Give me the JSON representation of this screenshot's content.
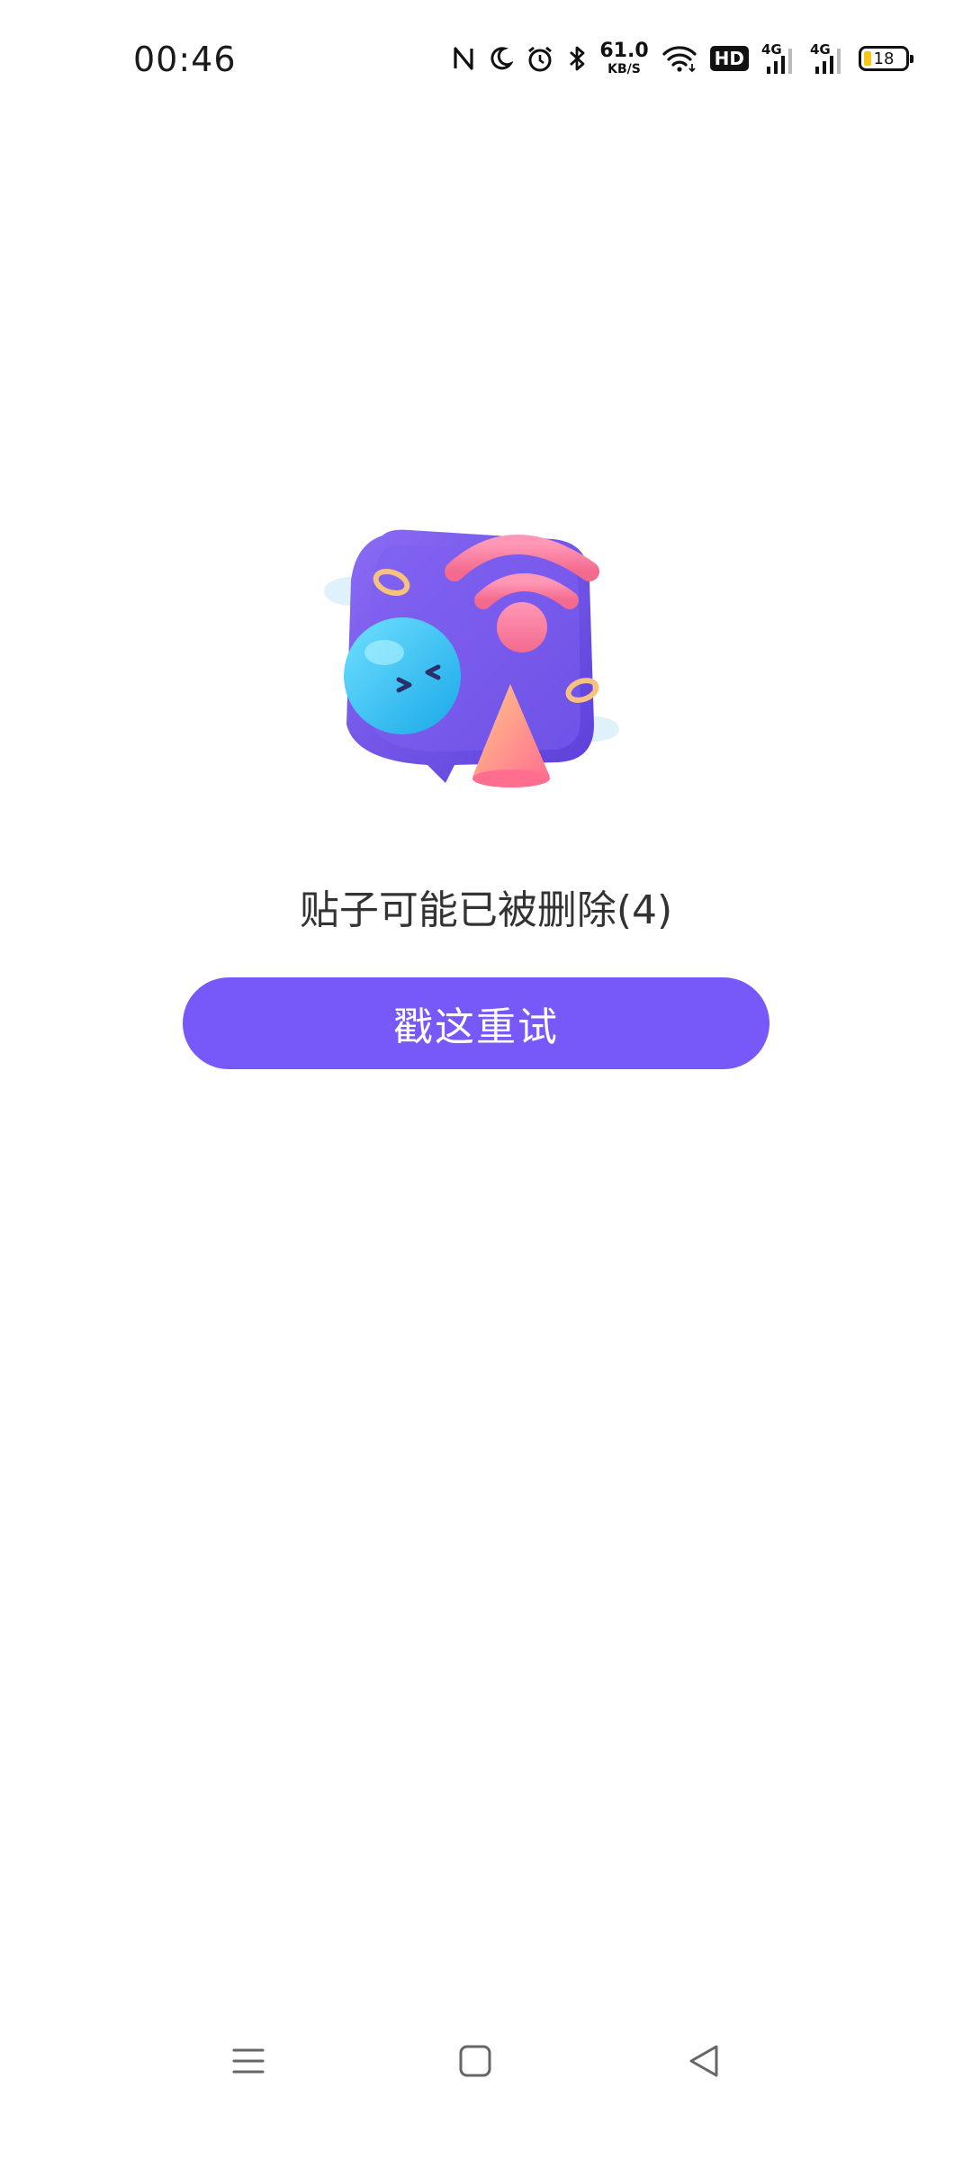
{
  "status_bar": {
    "time": "00:46",
    "net_speed_value": "61.0",
    "net_speed_unit": "KB/S",
    "hd_label": "HD",
    "sim1_label": "4G",
    "sim2_label": "4G",
    "battery_level": "18",
    "icons": [
      "nfc-icon",
      "moon-icon",
      "alarm-icon",
      "bluetooth-icon",
      "wifi-icon",
      "hd-icon",
      "signal-icon",
      "signal-icon",
      "battery-icon"
    ]
  },
  "content": {
    "message": "贴子可能已被删除(4)",
    "retry_label": "戳这重试",
    "accent_color": "#7759fa"
  },
  "nav_bar": {
    "icons": [
      "menu-icon",
      "home-icon",
      "back-icon"
    ]
  }
}
